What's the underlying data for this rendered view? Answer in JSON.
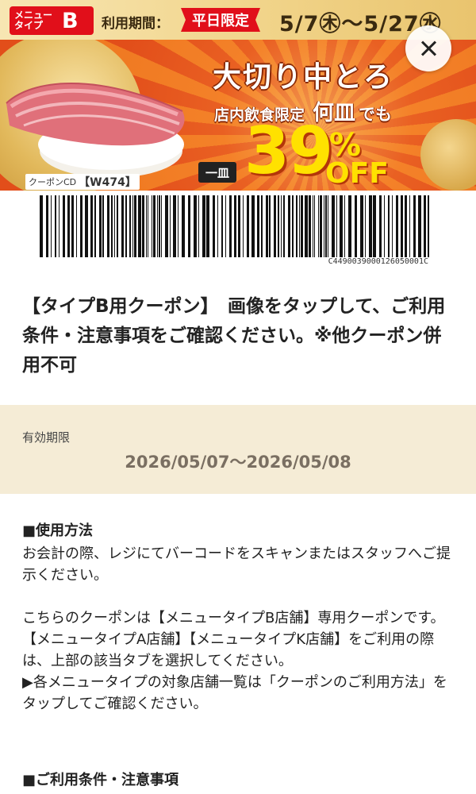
{
  "banner": {
    "menu_type_small": "メニュータイプ",
    "menu_type_letter": "B",
    "period_label": "利用期間：",
    "weekday_badge": "平日限定",
    "date_range": "5/7㊍〜5/27㊌",
    "product_name": "大切り中とろ",
    "dine_in_label": "店内飲食限定",
    "plates_label": "何皿",
    "plates_suffix": "でも",
    "per_plate_label": "一皿",
    "discount_value": "39",
    "percent_sign": "%",
    "off_label": "OFF",
    "coupon_cd_label": "クーポンCD",
    "coupon_code": "【W474】",
    "barcode_number": "C4490039000126050001C"
  },
  "close_button": {
    "icon": "close-icon"
  },
  "description": "【タイプB用クーポン】　画像をタップして、ご利用条件・注意事項をご確認ください。※他クーポン併用不可",
  "validity": {
    "label": "有効期限",
    "dates": "2026/05/07〜2026/05/08"
  },
  "usage": {
    "title": "■使用方法",
    "p1": "お会計の際、レジにてバーコードをスキャンまたはスタッフへご提示ください。",
    "p2": "こちらのクーポンは【メニュータイプB店舗】専用クーポンです。",
    "p3": "【メニュータイプA店舗】【メニュータイプK店舗】をご利用の際は、上部の該当タブを選択してください。",
    "p4": "▶各メニュータイプの対象店舗一覧は「クーポンのご利用方法」をタップしてご確認ください。"
  },
  "conditions": {
    "title": "■ご利用条件・注意事項"
  },
  "colors": {
    "brand_red": "#e10f1a",
    "banner_orange": "#f07a22",
    "discount_yellow": "#ffe100",
    "validity_bg": "#f5ecd6"
  }
}
